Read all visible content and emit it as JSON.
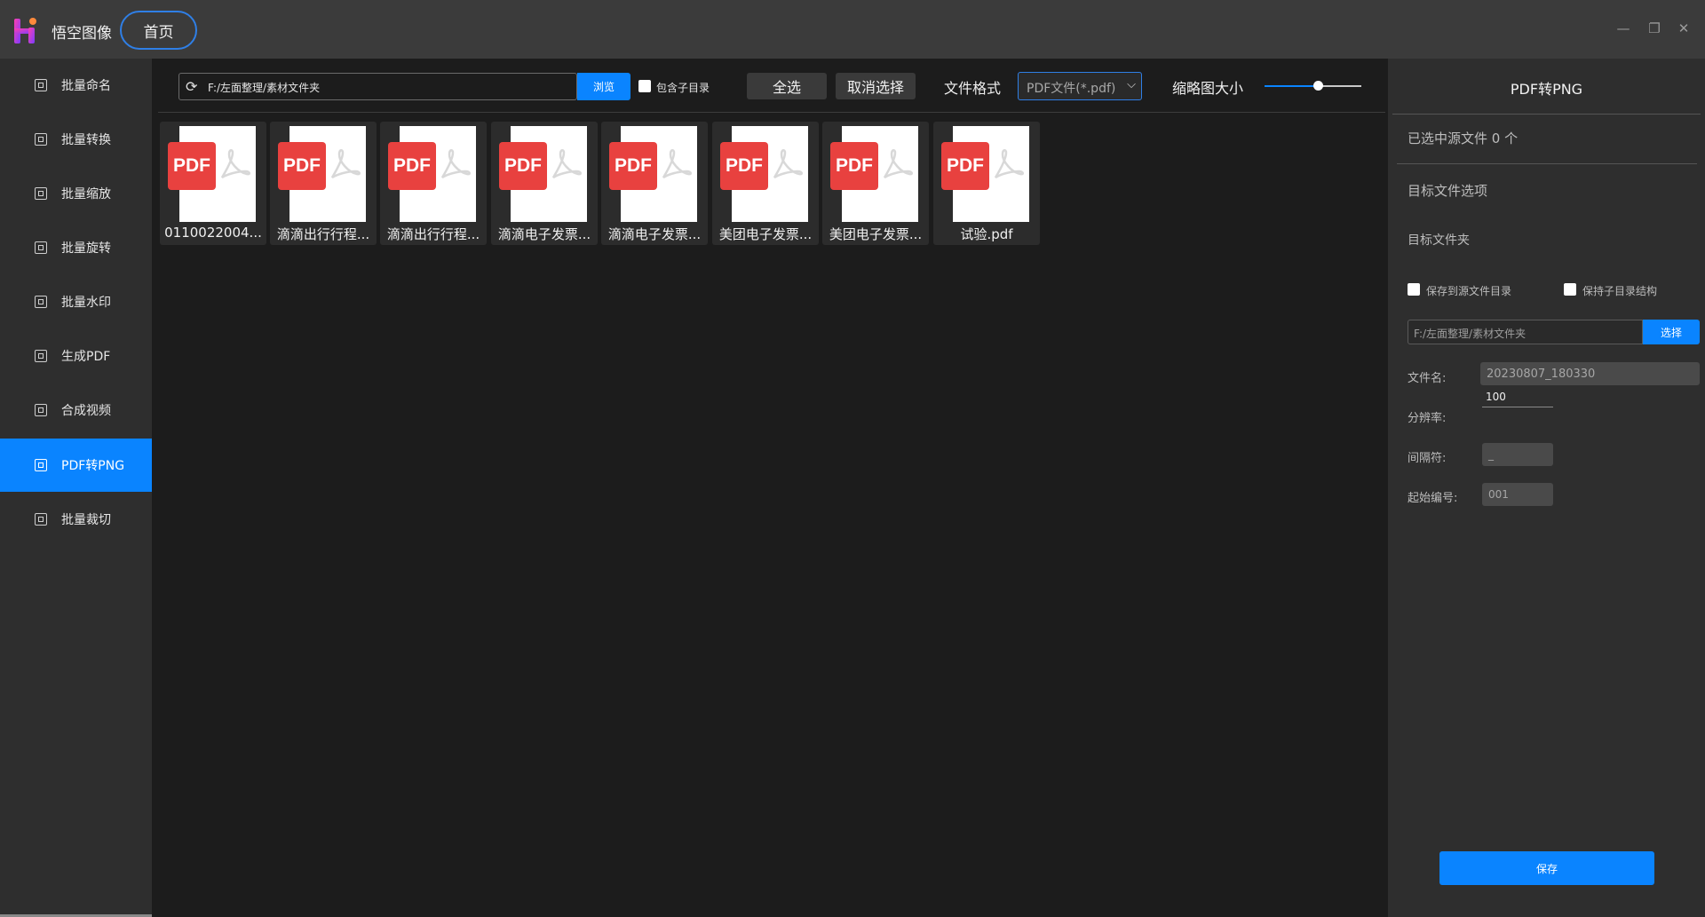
{
  "app": {
    "title": "悟空图像",
    "home_label": "首页"
  },
  "window_controls": [
    "minimize-icon",
    "restore-icon",
    "close-icon"
  ],
  "sidebar": {
    "items": [
      {
        "label": "批量命名",
        "icon": "rename-icon",
        "active": false
      },
      {
        "label": "批量转换",
        "icon": "convert-icon",
        "active": false
      },
      {
        "label": "批量缩放",
        "icon": "resize-icon",
        "active": false
      },
      {
        "label": "批量旋转",
        "icon": "rotate-icon",
        "active": false
      },
      {
        "label": "批量水印",
        "icon": "watermark-icon",
        "active": false
      },
      {
        "label": "生成PDF",
        "icon": "pdf-icon",
        "active": false
      },
      {
        "label": "合成视频",
        "icon": "video-icon",
        "active": false
      },
      {
        "label": "PDF转PNG",
        "icon": "pdf-to-png-icon",
        "active": true
      },
      {
        "label": "批量裁切",
        "icon": "crop-icon",
        "active": false
      }
    ]
  },
  "toolbar": {
    "path": "F:/左面整理/素材文件夹",
    "browse_label": "浏览",
    "include_subdir_label": "包含子目录",
    "select_all_label": "全选",
    "deselect_label": "取消选择",
    "format_label": "文件格式",
    "format_value": "PDF文件(*.pdf)",
    "thumb_size_label": "缩略图大小",
    "thumb_size_level": 0.55
  },
  "files": [
    {
      "name": "0110022004...",
      "badge": "PDF"
    },
    {
      "name": "滴滴出行行程...",
      "badge": "PDF"
    },
    {
      "name": "滴滴出行行程...",
      "badge": "PDF"
    },
    {
      "name": "滴滴电子发票...",
      "badge": "PDF"
    },
    {
      "name": "滴滴电子发票...",
      "badge": "PDF"
    },
    {
      "name": "美团电子发票...",
      "badge": "PDF"
    },
    {
      "name": "美团电子发票...",
      "badge": "PDF"
    },
    {
      "name": "试验.pdf",
      "badge": "PDF"
    }
  ],
  "panel": {
    "title": "PDF转PNG",
    "selected_count": "已选中源文件 0 个",
    "target_options_label": "目标文件选项",
    "target_folder_label": "目标文件夹",
    "save_to_source_label": "保存到源文件目录",
    "keep_structure_label": "保持子目录结构",
    "target_path": "F:/左面整理/素材文件夹",
    "choose_label": "选择",
    "filename_label": "文件名:",
    "filename_value": "20230807_180330",
    "resolution_label": "分辨率:",
    "resolution_value": "100",
    "separator_label": "间隔符:",
    "separator_value": "_",
    "start_number_label": "起始编号:",
    "start_number_value": "001",
    "save_label": "保存"
  }
}
